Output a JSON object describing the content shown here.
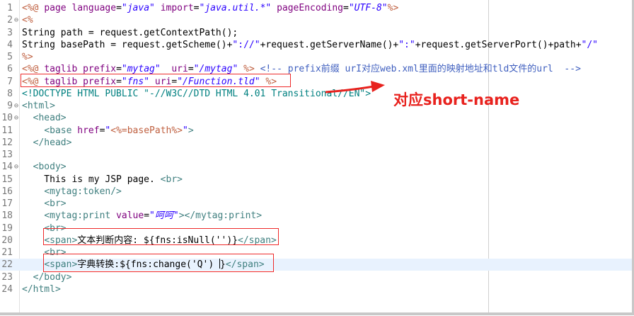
{
  "editor": {
    "lines": [
      {
        "n": "1",
        "fold": "",
        "parts": [
          [
            "jsp",
            "<%@ "
          ],
          [
            "attr",
            "page "
          ],
          [
            "attr",
            "language"
          ],
          [
            "bind-plain",
            "="
          ],
          [
            "val",
            "\"java\""
          ],
          [
            "bind-plain",
            " "
          ],
          [
            "attr",
            "import"
          ],
          [
            "bind-plain",
            "="
          ],
          [
            "val",
            "\"java.util.*\""
          ],
          [
            "bind-plain",
            " "
          ],
          [
            "attr",
            "pageEncoding"
          ],
          [
            "bind-plain",
            "="
          ],
          [
            "val",
            "\"UTF-8\""
          ],
          [
            "jsp",
            "%>"
          ]
        ]
      },
      {
        "n": "2",
        "fold": "⊖",
        "parts": [
          [
            "jsp",
            "<%"
          ]
        ]
      },
      {
        "n": "3",
        "fold": "",
        "parts": [
          [
            "bind-plain",
            "String path = request.getContextPath();"
          ]
        ]
      },
      {
        "n": "4",
        "fold": "",
        "parts": [
          [
            "bind-plain",
            "String basePath = request.getScheme()+"
          ],
          [
            "str",
            "\"://\""
          ],
          [
            "bind-plain",
            "+request.getServerName()+"
          ],
          [
            "str",
            "\":\""
          ],
          [
            "bind-plain",
            "+request.getServerPort()+path+"
          ],
          [
            "str",
            "\"/\""
          ]
        ]
      },
      {
        "n": "5",
        "fold": "",
        "parts": [
          [
            "jsp",
            "%>"
          ]
        ]
      },
      {
        "n": "6",
        "fold": "",
        "parts": [
          [
            "jsp",
            "<%@ "
          ],
          [
            "attr",
            "taglib "
          ],
          [
            "attr",
            "prefix"
          ],
          [
            "bind-plain",
            "="
          ],
          [
            "val",
            "\"mytag\""
          ],
          [
            "bind-plain",
            "  "
          ],
          [
            "attr",
            "uri"
          ],
          [
            "bind-plain",
            "="
          ],
          [
            "val",
            "\"/mytag\""
          ],
          [
            "bind-plain",
            " "
          ],
          [
            "jsp",
            "%>"
          ],
          [
            "bind-plain",
            " "
          ],
          [
            "cmt",
            "<!-- prefix前缀 urI对应web.xml里面的映射地址和tld文件的url  -->"
          ]
        ]
      },
      {
        "n": "7",
        "fold": "",
        "parts": [
          [
            "jsp",
            "<%@ "
          ],
          [
            "attr",
            "taglib "
          ],
          [
            "attr",
            "prefix"
          ],
          [
            "bind-plain",
            "="
          ],
          [
            "val",
            "\"fns\""
          ],
          [
            "bind-plain",
            " "
          ],
          [
            "attr",
            "uri"
          ],
          [
            "bind-plain",
            "="
          ],
          [
            "val",
            "\"/Function.tld\""
          ],
          [
            "bind-plain",
            " "
          ],
          [
            "jsp",
            "%>"
          ]
        ]
      },
      {
        "n": "8",
        "fold": "",
        "parts": [
          [
            "doc",
            "<!DOCTYPE HTML PUBLIC \"-//W3C//DTD HTML 4.01 Transitional//EN\">"
          ]
        ]
      },
      {
        "n": "9",
        "fold": "⊖",
        "parts": [
          [
            "tag",
            "<html>"
          ]
        ]
      },
      {
        "n": "10",
        "fold": "⊖",
        "parts": [
          [
            "bind-plain",
            "  "
          ],
          [
            "tag",
            "<head>"
          ]
        ]
      },
      {
        "n": "11",
        "fold": "",
        "parts": [
          [
            "bind-plain",
            "    "
          ],
          [
            "tag",
            "<base "
          ],
          [
            "attr",
            "href"
          ],
          [
            "bind-plain",
            "="
          ],
          [
            "str",
            "\""
          ],
          [
            "jsp",
            "<%=basePath%>"
          ],
          [
            "str",
            "\""
          ],
          [
            "tag",
            ">"
          ]
        ]
      },
      {
        "n": "12",
        "fold": "",
        "parts": [
          [
            "bind-plain",
            "  "
          ],
          [
            "tag",
            "</head>"
          ]
        ]
      },
      {
        "n": "13",
        "fold": "",
        "parts": [
          [
            "bind-plain",
            ""
          ]
        ]
      },
      {
        "n": "14",
        "fold": "⊖",
        "parts": [
          [
            "bind-plain",
            "  "
          ],
          [
            "tag",
            "<body>"
          ]
        ]
      },
      {
        "n": "15",
        "fold": "",
        "parts": [
          [
            "bind-plain",
            "    This is my JSP page. "
          ],
          [
            "tag",
            "<br>"
          ]
        ]
      },
      {
        "n": "16",
        "fold": "",
        "parts": [
          [
            "bind-plain",
            "    "
          ],
          [
            "tag",
            "<mytag:token/>"
          ]
        ]
      },
      {
        "n": "17",
        "fold": "",
        "parts": [
          [
            "bind-plain",
            "    "
          ],
          [
            "tag",
            "<br>"
          ]
        ]
      },
      {
        "n": "18",
        "fold": "",
        "parts": [
          [
            "bind-plain",
            "    "
          ],
          [
            "tag",
            "<mytag:print "
          ],
          [
            "attr",
            "value"
          ],
          [
            "bind-plain",
            "="
          ],
          [
            "val",
            "\"呵呵\""
          ],
          [
            "tag",
            "></mytag:print>"
          ]
        ]
      },
      {
        "n": "19",
        "fold": "",
        "parts": [
          [
            "bind-plain",
            "    "
          ],
          [
            "tag",
            "<br>"
          ]
        ]
      },
      {
        "n": "20",
        "fold": "",
        "parts": [
          [
            "bind-plain",
            "    "
          ],
          [
            "tag",
            "<span>"
          ],
          [
            "bind-plain",
            "文本判断内容: ${fns:isNull('')}"
          ],
          [
            "tag",
            "</span>"
          ]
        ]
      },
      {
        "n": "21",
        "fold": "",
        "parts": [
          [
            "bind-plain",
            "    "
          ],
          [
            "tag",
            "<br>"
          ]
        ]
      },
      {
        "n": "22",
        "fold": "",
        "parts": [
          [
            "bind-plain",
            "    "
          ],
          [
            "tag",
            "<span>"
          ],
          [
            "bind-plain",
            "字典转换:${fns:change('Q') "
          ],
          [
            "cursor",
            ""
          ],
          [
            "bind-plain",
            "}"
          ],
          [
            "tag",
            "</span>"
          ]
        ]
      },
      {
        "n": "23",
        "fold": "",
        "parts": [
          [
            "bind-plain",
            "  "
          ],
          [
            "tag",
            "</body>"
          ]
        ]
      },
      {
        "n": "24",
        "fold": "",
        "parts": [
          [
            "tag",
            "</html>"
          ]
        ]
      }
    ],
    "current_line": "22"
  },
  "annotation": {
    "label": "对应short-name",
    "color": "#e8221e"
  }
}
